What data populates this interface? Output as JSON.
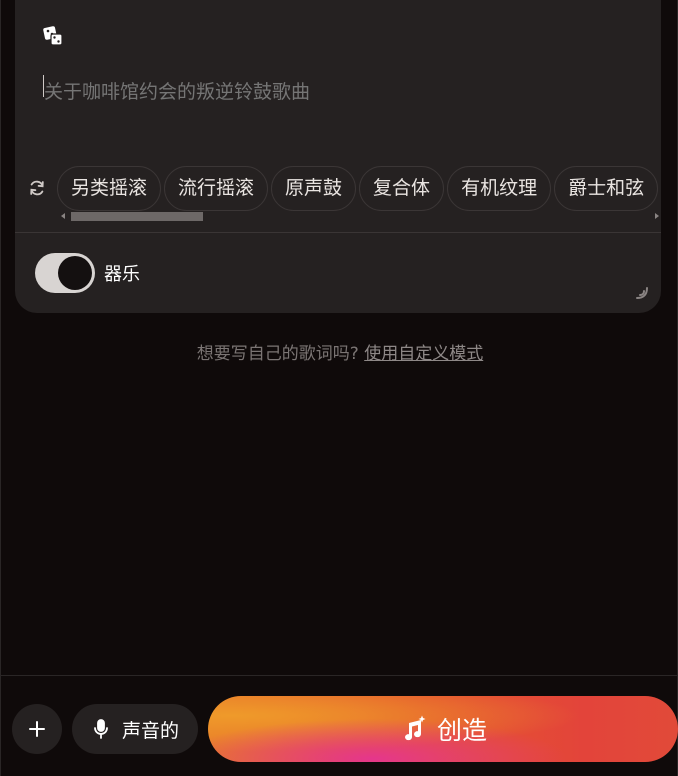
{
  "prompt": {
    "placeholder": "关于咖啡馆约会的叛逆铃鼓歌曲",
    "dice_icon": "dice-icon"
  },
  "tags": {
    "refresh_icon": "refresh-icon",
    "items": [
      "另类摇滚",
      "流行摇滚",
      "原声鼓",
      "复合体",
      "有机纹理",
      "爵士和弦"
    ]
  },
  "instrumental": {
    "label": "器乐",
    "enabled": true
  },
  "lyrics_hint": {
    "text": "想要写自己的歌词吗?",
    "link": "使用自定义模式"
  },
  "bottom": {
    "voice_label": "声音的",
    "create_label": "创造"
  },
  "colors": {
    "background": "#0f0a0a",
    "card": "#252121",
    "create_orange": "#e5572f",
    "create_pink": "#e5368c"
  }
}
